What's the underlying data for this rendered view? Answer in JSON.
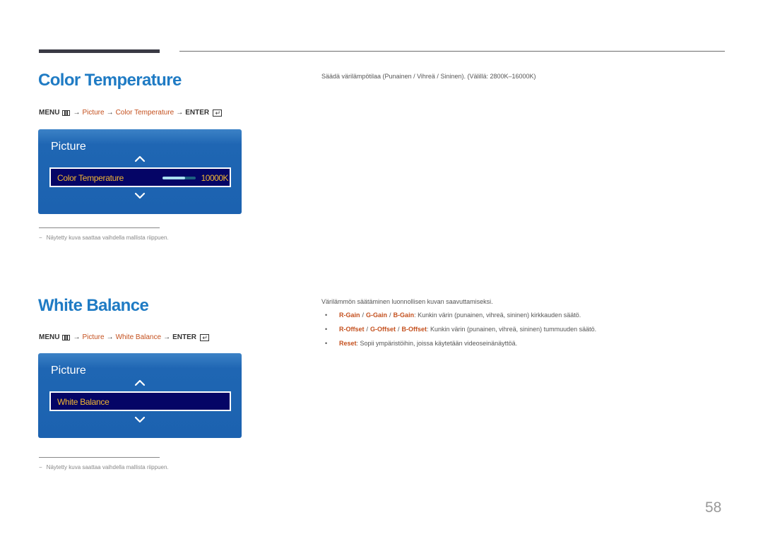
{
  "page_number": "58",
  "sections": {
    "color_temperature": {
      "title": "Color Temperature",
      "menu_path": {
        "menu": "MENU",
        "arrow": "→",
        "picture": "Picture",
        "item": "Color Temperature",
        "enter": "ENTER"
      },
      "osd": {
        "title": "Picture",
        "item_label": "Color Temperature",
        "value": "10000K",
        "slider_fraction": 0.68
      },
      "description": "Säädä värilämpötilaa (Punainen / Vihreä / Sininen). (Välillä: 2800K–16000K)",
      "footnote": "Näytetty kuva saattaa vaihdella mallista riippuen."
    },
    "white_balance": {
      "title": "White Balance",
      "menu_path": {
        "menu": "MENU",
        "arrow": "→",
        "picture": "Picture",
        "item": "White Balance",
        "enter": "ENTER"
      },
      "osd": {
        "title": "Picture",
        "item_label": "White Balance"
      },
      "description": "Värilämmön säätäminen luonnollisen kuvan saavuttamiseksi.",
      "bullets": [
        {
          "terms": [
            "R-Gain",
            "G-Gain",
            "B-Gain"
          ],
          "text": ": Kunkin värin (punainen, vihreä, sininen) kirkkauden säätö."
        },
        {
          "terms": [
            "R-Offset",
            "G-Offset",
            "B-Offset"
          ],
          "text": ": Kunkin värin (punainen, vihreä, sininen) tummuuden säätö."
        },
        {
          "terms": [
            "Reset"
          ],
          "text": ": Sopii ympäristöihin, joissa käytetään videoseinänäyttöä."
        }
      ],
      "footnote": "Näytetty kuva saattaa vaihdella mallista riippuen."
    }
  },
  "common": {
    "separator": "/",
    "bullet": "•",
    "footnote_dash": "−"
  },
  "colors": {
    "heading_blue": "#1f7bc4",
    "link_orange": "#c4501e",
    "osd_blue": "#1c62b0",
    "osd_selected": "#050566",
    "osd_text_gold": "#f1b632"
  }
}
